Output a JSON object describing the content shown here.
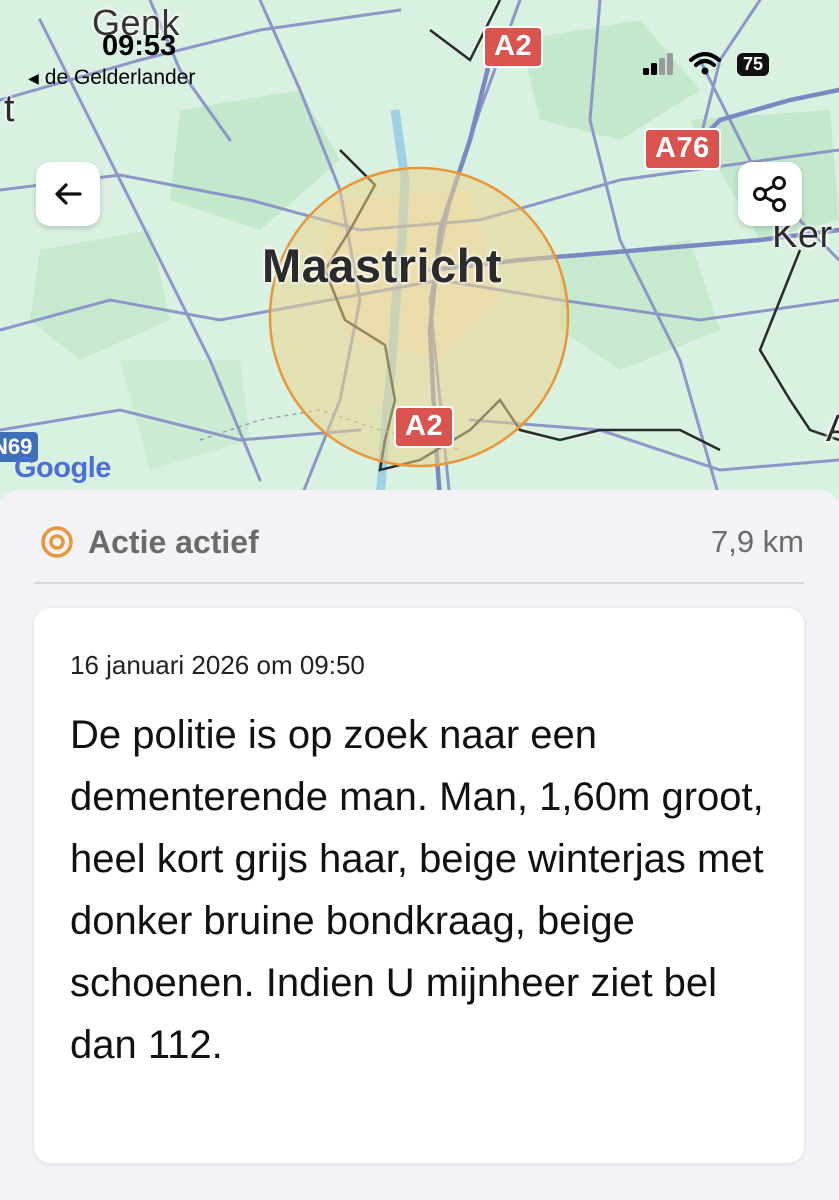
{
  "status_bar": {
    "time": "09:53",
    "back_app": "de Gelderlander",
    "battery": "75"
  },
  "map": {
    "city_main": "Maastricht",
    "city_top": "Genk",
    "city_right_partial": "Ker",
    "city_left_partial": "t",
    "right_edge_partial": "A",
    "road_a2_top": "A2",
    "road_a76": "A76",
    "road_a2_bottom": "A2",
    "road_n69": "N69",
    "attribution": "Google",
    "radius_color": "#f0b43c",
    "road_color": "#d9534f"
  },
  "buttons": {
    "back_icon": "arrow-left-icon",
    "share_icon": "share-icon"
  },
  "alert": {
    "status_icon": "target-icon",
    "status": "Actie actief",
    "distance": "7,9 km",
    "accent_color": "#e8963a",
    "date": "16 januari 2026 om 09:50",
    "message": "De politie is op zoek naar een dementerende man. Man, 1,60m groot, heel kort grijs haar, beige winterjas met donker bruine bondkraag, beige schoenen. Indien U mijnheer ziet bel dan 112."
  }
}
